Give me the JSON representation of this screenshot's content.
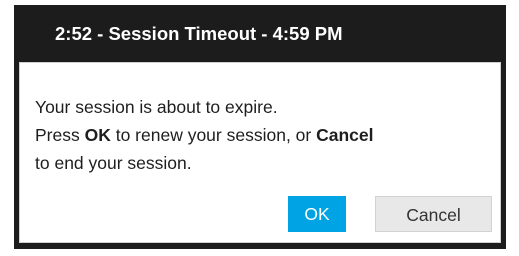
{
  "dialog": {
    "title": "2:52 - Session Timeout - 4:59 PM",
    "message": {
      "line1": "Your session is about to expire.",
      "line2_prefix": "Press ",
      "line2_ok": "OK",
      "line2_middle": " to renew your session, or ",
      "line2_cancel": "Cancel",
      "line3": "to end your session."
    },
    "buttons": {
      "ok_label": "OK",
      "cancel_label": "Cancel"
    }
  },
  "colors": {
    "titlebar_bg": "#1c1c1c",
    "ok_button_bg": "#00a4e4",
    "cancel_button_bg": "#e8e8e8"
  }
}
